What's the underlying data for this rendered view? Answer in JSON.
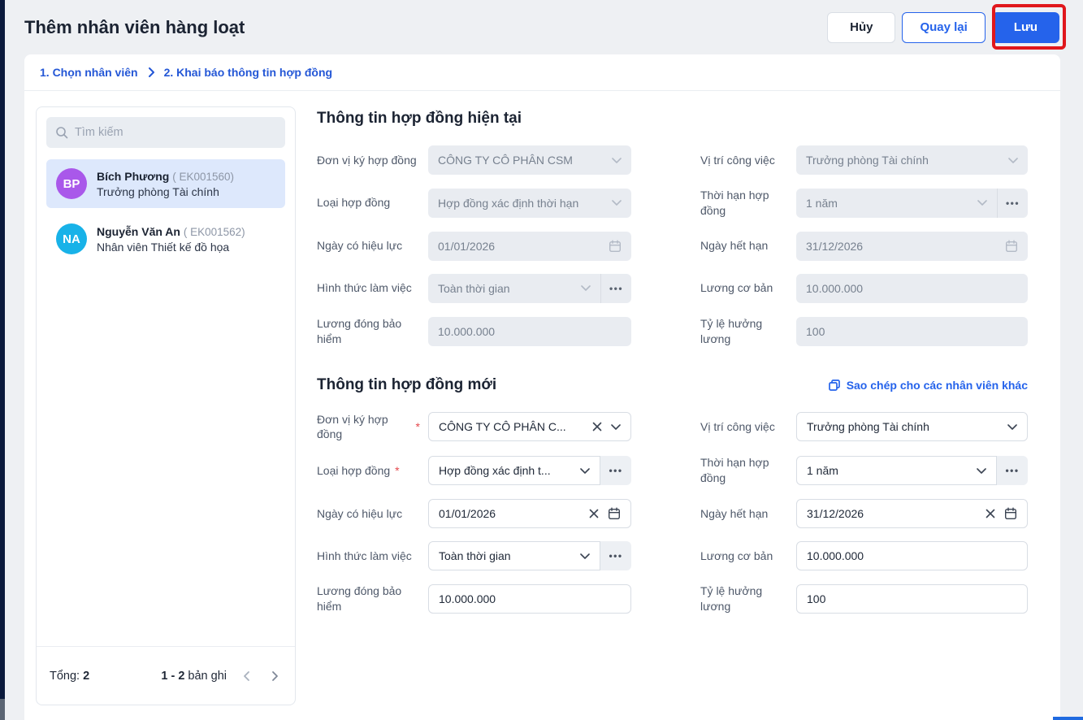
{
  "header": {
    "title": "Thêm nhân viên hàng loạt",
    "cancel_label": "Hủy",
    "back_label": "Quay lại",
    "save_label": "Lưu"
  },
  "breadcrumb": {
    "step1": "1. Chọn nhân viên",
    "step2": "2. Khai báo thông tin hợp đồng"
  },
  "sidebar": {
    "search_placeholder": "Tìm kiếm",
    "employees": [
      {
        "initials": "BP",
        "name": "Bích Phương",
        "code": "( EK001560)",
        "role": "Trưởng phòng Tài chính",
        "color": "#a958ea",
        "selected": true
      },
      {
        "initials": "NA",
        "name": "Nguyễn Văn An",
        "code": "( EK001562)",
        "role": "Nhân viên Thiết kế đồ họa",
        "color": "#18b2e8",
        "selected": false
      }
    ],
    "footer": {
      "total_label": "Tổng:",
      "total_value": "2",
      "range": "1 - 2",
      "records_label": "bản ghi"
    }
  },
  "current_contract": {
    "title": "Thông tin hợp đồng hiện tại",
    "disabled": true,
    "fields": [
      {
        "name": "don-vi-ky-hop-dong",
        "label": "Đơn vị ký hợp đồng",
        "value": "CÔNG TY CÔ PHÂN CSM",
        "type": "select"
      },
      {
        "name": "vi-tri-cong-viec",
        "label": "Vị trí công việc",
        "value": "Trưởng phòng Tài chính",
        "type": "select"
      },
      {
        "name": "loai-hop-dong",
        "label": "Loại hợp đồng",
        "value": "Hợp đồng xác định thời hạn",
        "type": "select"
      },
      {
        "name": "thoi-han-hop-dong",
        "label": "Thời hạn hợp đồng",
        "value": "1 năm",
        "type": "select",
        "dots": true
      },
      {
        "name": "ngay-co-hieu-luc",
        "label": "Ngày có hiệu lực",
        "value": "01/01/2026",
        "type": "date"
      },
      {
        "name": "ngay-het-han",
        "label": "Ngày hết hạn",
        "value": "31/12/2026",
        "type": "date"
      },
      {
        "name": "hinh-thuc-lam-viec",
        "label": "Hình thức làm việc",
        "value": "Toàn thời gian",
        "type": "select",
        "dots": true
      },
      {
        "name": "luong-co-ban",
        "label": "Lương cơ bản",
        "value": "10.000.000",
        "type": "text"
      },
      {
        "name": "luong-dong-bao-hiem",
        "label": "Lương đóng bảo hiểm",
        "value": "10.000.000",
        "type": "text"
      },
      {
        "name": "ty-le-huong-luong",
        "label": "Tỷ lệ hưởng lương",
        "value": "100",
        "type": "text"
      }
    ]
  },
  "new_contract": {
    "title": "Thông tin hợp đồng mới",
    "copy_link_label": "Sao chép cho các nhân viên khác",
    "disabled": false,
    "fields": [
      {
        "name": "don-vi-ky-hop-dong",
        "label": "Đơn vị ký hợp đồng",
        "required": true,
        "value": "CÔNG TY CÔ PHÂN C...",
        "type": "select",
        "clear": true
      },
      {
        "name": "vi-tri-cong-viec",
        "label": "Vị trí công việc",
        "value": "Trưởng phòng Tài chính",
        "type": "select"
      },
      {
        "name": "loai-hop-dong",
        "label": "Loại hợp đồng",
        "required": true,
        "value": "Hợp đồng xác định t...",
        "type": "select",
        "dots": true
      },
      {
        "name": "thoi-han-hop-dong",
        "label": "Thời hạn hợp đồng",
        "value": "1 năm",
        "type": "select",
        "dots": true
      },
      {
        "name": "ngay-co-hieu-luc",
        "label": "Ngày có hiệu lực",
        "value": "01/01/2026",
        "type": "date",
        "clear": true
      },
      {
        "name": "ngay-het-han",
        "label": "Ngày hết hạn",
        "value": "31/12/2026",
        "type": "date",
        "clear": true
      },
      {
        "name": "hinh-thuc-lam-viec",
        "label": "Hình thức làm việc",
        "value": "Toàn thời gian",
        "type": "select",
        "dots": true
      },
      {
        "name": "luong-co-ban",
        "label": "Lương cơ bản",
        "value": "10.000.000",
        "type": "text"
      },
      {
        "name": "luong-dong-bao-hiem",
        "label": "Lương đóng bảo hiểm",
        "value": "10.000.000",
        "type": "text"
      },
      {
        "name": "ty-le-huong-luong",
        "label": "Tỷ lệ hưởng lương",
        "value": "100",
        "type": "text"
      }
    ]
  },
  "colors": {
    "primary": "#2563eb",
    "annotation": "#e0171c",
    "selected_row": "#dde8fc"
  }
}
